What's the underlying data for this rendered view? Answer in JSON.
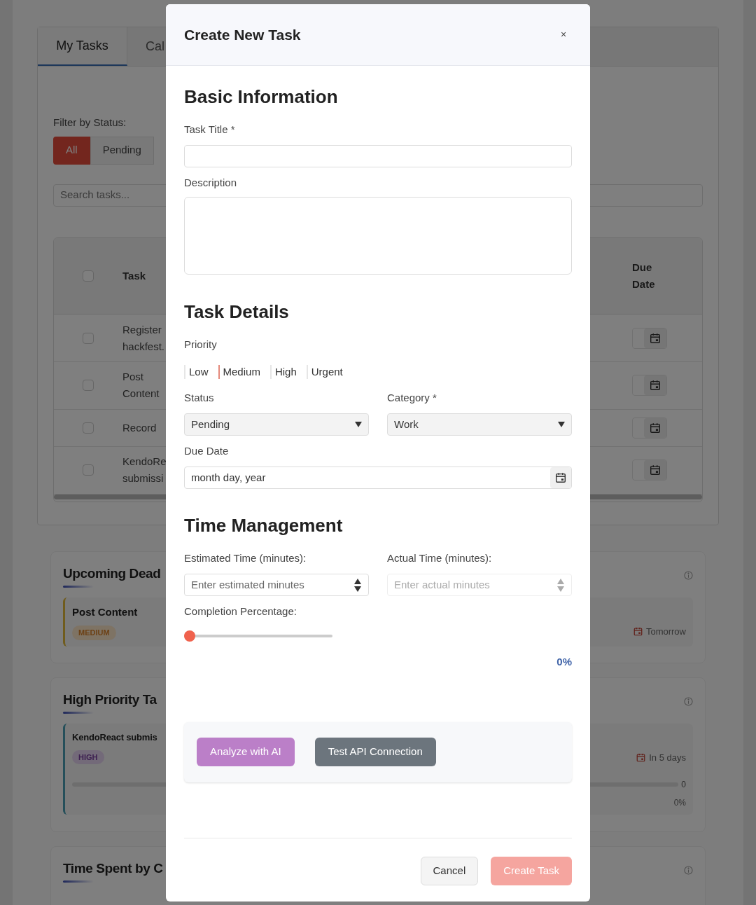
{
  "tabs": [
    {
      "label": "My Tasks",
      "selected": true
    },
    {
      "label": "Cal",
      "selected": false
    }
  ],
  "filter": {
    "label": "Filter by Status:",
    "options": [
      {
        "label": "All",
        "selected": true
      },
      {
        "label": "Pending",
        "selected": false
      }
    ]
  },
  "search": {
    "placeholder": "Search tasks..."
  },
  "table": {
    "header_checked": false,
    "columns": [
      "Task",
      "Due Date"
    ],
    "rows": [
      {
        "checked": false,
        "task": "Register hackfest."
      },
      {
        "checked": false,
        "task": "Post Content"
      },
      {
        "checked": false,
        "task": "Record"
      },
      {
        "checked": false,
        "task": "KendoRe submissi"
      }
    ]
  },
  "upcoming": {
    "title": "Upcoming Dead",
    "items": [
      {
        "title": "Post Content",
        "priority": "MEDIUM",
        "kind": "medium",
        "due": "Tomorrow"
      }
    ]
  },
  "high_priority": {
    "title": "High Priority Ta",
    "items": [
      {
        "title": "KendoReact submis",
        "priority": "HIGH",
        "kind": "high",
        "due": "In 5 days",
        "level": 0,
        "count": "0",
        "percent": "0%"
      }
    ]
  },
  "time_spent": {
    "title": "Time Spent by C"
  },
  "modal": {
    "title": "Create New Task",
    "close": "×",
    "basic": {
      "heading": "Basic Information",
      "title_label": "Task Title *",
      "description_label": "Description"
    },
    "details": {
      "heading": "Task Details",
      "priority_label": "Priority",
      "priorities": [
        {
          "label": "Low",
          "selected": false
        },
        {
          "label": "Medium",
          "selected": true
        },
        {
          "label": "High",
          "selected": false
        },
        {
          "label": "Urgent",
          "selected": false
        }
      ],
      "status": {
        "label": "Status",
        "value": "Pending"
      },
      "category": {
        "label": "Category *",
        "value": "Work"
      },
      "due": {
        "label": "Due Date",
        "value": "month day, year"
      }
    },
    "time": {
      "heading": "Time Management",
      "estimated": {
        "label": "Estimated Time (minutes):",
        "placeholder": "Enter estimated minutes",
        "disabled": false
      },
      "actual": {
        "label": "Actual Time (minutes):",
        "placeholder": "Enter actual minutes",
        "disabled": true
      },
      "completion": {
        "label": "Completion Percentage:",
        "level": 0,
        "reading": "0%"
      }
    },
    "ai_buttons": [
      {
        "label": "Analyze with AI",
        "kind": "ai"
      },
      {
        "label": "Test API Connection",
        "kind": "test"
      }
    ],
    "footer": {
      "cancel": "Cancel",
      "submit": "Create Task",
      "submit_disabled": true
    }
  }
}
